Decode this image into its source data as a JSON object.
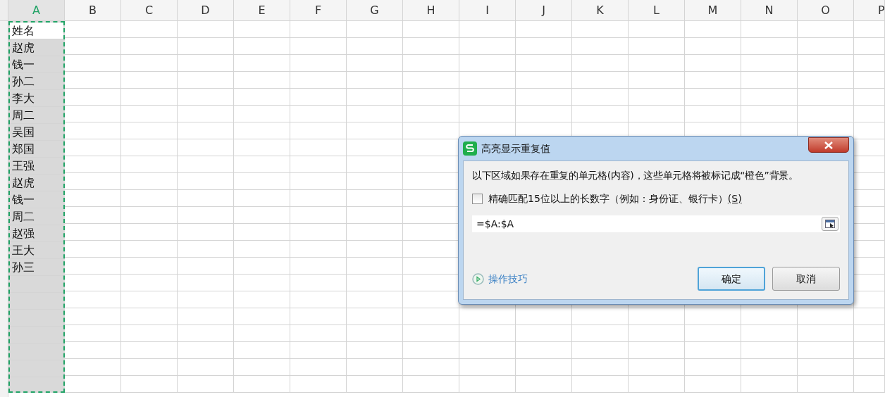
{
  "columns": [
    {
      "label": "A",
      "selected": true,
      "cells": [
        {
          "text": "姓名",
          "active": true
        },
        {
          "text": "赵虎",
          "active": false
        },
        {
          "text": "钱一",
          "active": false
        },
        {
          "text": "孙二",
          "active": false
        },
        {
          "text": "李大",
          "active": false
        },
        {
          "text": "周二",
          "active": false
        },
        {
          "text": "吴国",
          "active": false
        },
        {
          "text": "郑国",
          "active": false
        },
        {
          "text": "王强",
          "active": false
        },
        {
          "text": "赵虎",
          "active": false
        },
        {
          "text": "钱一",
          "active": false
        },
        {
          "text": "周二",
          "active": false
        },
        {
          "text": "赵强",
          "active": false
        },
        {
          "text": "王大",
          "active": false
        },
        {
          "text": "孙三",
          "active": false
        }
      ]
    },
    {
      "label": "B",
      "selected": false
    },
    {
      "label": "C",
      "selected": false
    },
    {
      "label": "D",
      "selected": false
    },
    {
      "label": "E",
      "selected": false
    },
    {
      "label": "F",
      "selected": false
    },
    {
      "label": "G",
      "selected": false
    },
    {
      "label": "H",
      "selected": false
    },
    {
      "label": "I",
      "selected": false
    },
    {
      "label": "J",
      "selected": false
    },
    {
      "label": "K",
      "selected": false
    },
    {
      "label": "L",
      "selected": false
    },
    {
      "label": "M",
      "selected": false
    },
    {
      "label": "N",
      "selected": false
    },
    {
      "label": "O",
      "selected": false
    },
    {
      "label": "P",
      "selected": false
    }
  ],
  "dialog": {
    "title": "高亮显示重复值",
    "message": "以下区域如果存在重复的单元格(内容)，这些单元格将被标记成“橙色”背景。",
    "checkbox": {
      "label": "精确匹配15位以上的长数字（例如：身份证、银行卡）",
      "shortcut": "(S)",
      "checked": false
    },
    "range": {
      "value": "=$A:$A"
    },
    "tips_link": "操作技巧",
    "buttons": [
      {
        "label": "确定",
        "kind": "primary"
      },
      {
        "label": "取消",
        "kind": "secondary"
      }
    ]
  }
}
